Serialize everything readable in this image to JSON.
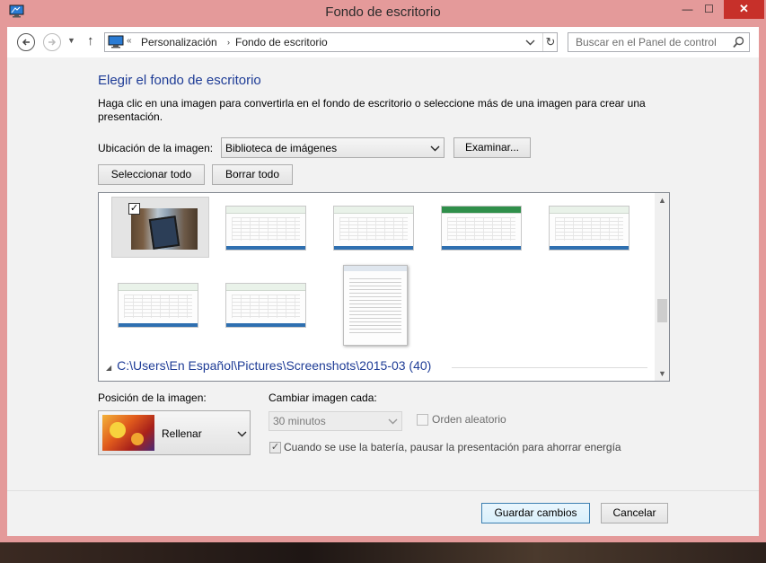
{
  "window": {
    "title": "Fondo de escritorio",
    "close_glyph": "✕",
    "min_glyph": "—",
    "max_glyph": "☐"
  },
  "navbar": {
    "breadcrumb_root_glyph": "«",
    "crumb_1": "Personalización",
    "crumb_sep": "›",
    "crumb_2": "Fondo de escritorio",
    "search_placeholder": "Buscar en el Panel de control"
  },
  "content": {
    "heading": "Elegir el fondo de escritorio",
    "description": "Haga clic en una imagen para convertirla en el fondo de escritorio o seleccione más de una imagen para crear una presentación.",
    "location_label": "Ubicación de la imagen:",
    "location_value": "Biblioteca de imágenes",
    "browse_label": "Examinar...",
    "select_all_label": "Seleccionar todo",
    "clear_all_label": "Borrar todo"
  },
  "gallery": {
    "group_header": "C:\\Users\\En Español\\Pictures\\Screenshots\\2015-03 (40)",
    "collapse_glyph": "◢",
    "selected_check": "✓"
  },
  "options": {
    "position_label": "Posición de la imagen:",
    "position_value": "Rellenar",
    "change_label": "Cambiar imagen cada:",
    "interval_value": "30 minutos",
    "shuffle_label": "Orden aleatorio",
    "battery_label": "Cuando se use la batería, pausar la presentación para ahorrar energía",
    "battery_checked_glyph": "✓"
  },
  "footer": {
    "save_label": "Guardar cambios",
    "cancel_label": "Cancelar"
  },
  "colors": {
    "accent_heading": "#1e3c96",
    "close_button": "#c7302a",
    "window_frame": "#e49a9a"
  }
}
